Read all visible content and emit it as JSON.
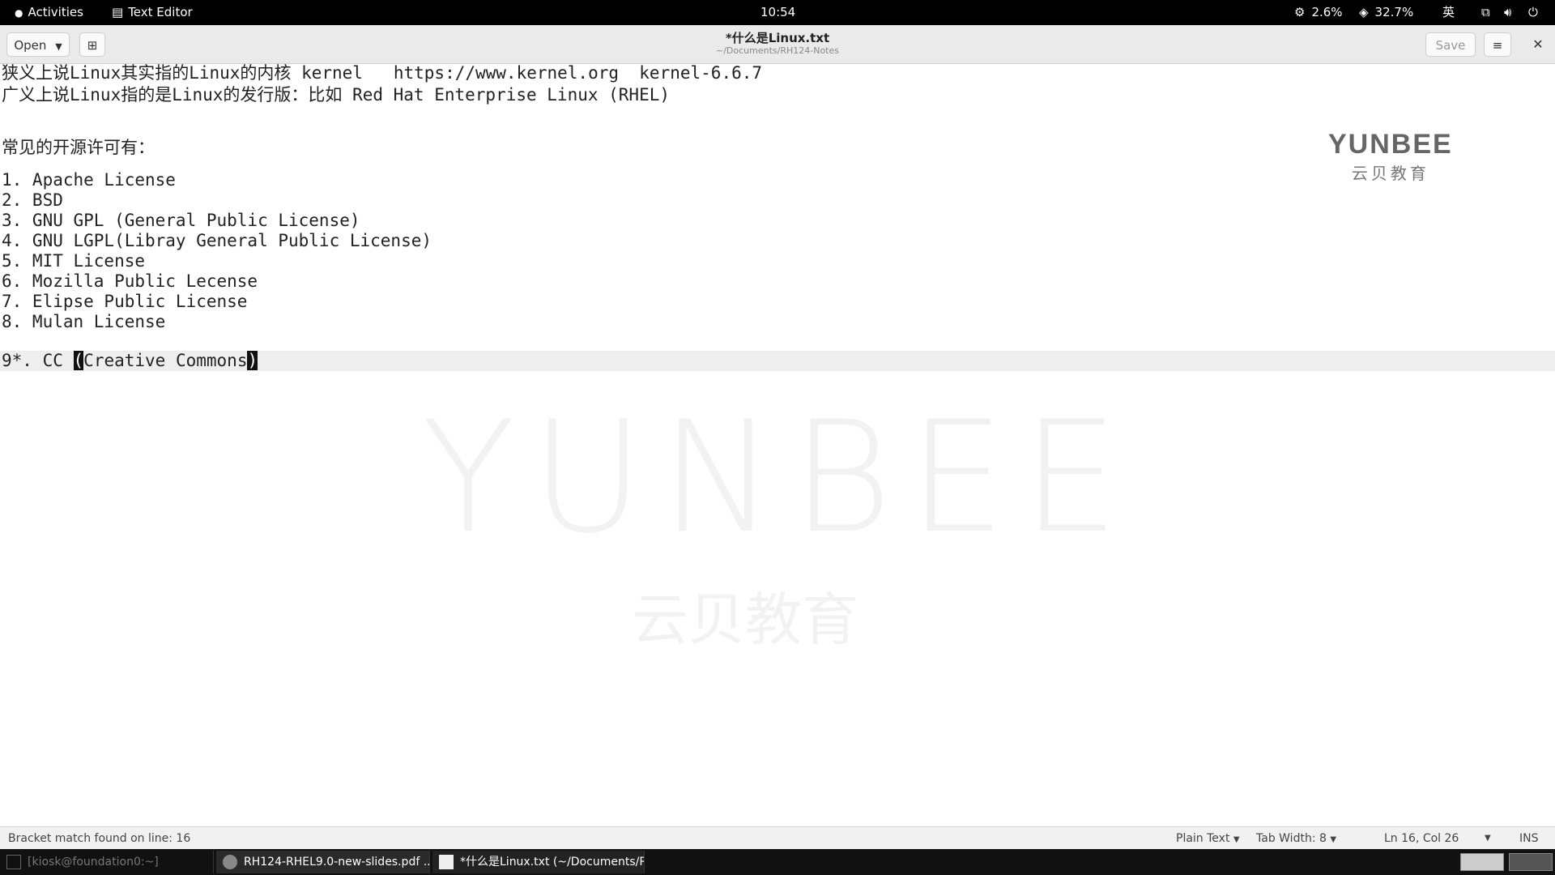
{
  "topbar": {
    "activities": "Activities",
    "app_name": "Text Editor",
    "clock": "10:54",
    "cpu": "2.6%",
    "mem": "32.7%",
    "input_method": "英"
  },
  "header": {
    "open_label": "Open",
    "title": "*什么是Linux.txt",
    "subtitle": "~/Documents/RH124-Notes",
    "save_label": "Save"
  },
  "editor": {
    "lines": [
      "狭义上说Linux其实指的Linux的内核 kernel   https://www.kernel.org  kernel-6.6.7",
      "广义上说Linux指的是Linux的发行版：比如 Red Hat Enterprise Linux (RHEL)",
      "常见的开源许可有：",
      "1. Apache License",
      "2. BSD",
      "3. GNU GPL (General Public License)",
      "4. GNU LGPL(Libray General Public License)",
      "5. MIT License",
      "6. Mozilla Public Lecense",
      "7. Elipse Public License",
      "8. Mulan License"
    ],
    "current_line": {
      "prefix": "9*. CC ",
      "open_bracket": "(",
      "middle": "Creative Commons",
      "close_bracket": ")"
    }
  },
  "watermark": {
    "big": "YUNBEE",
    "cn": "云贝教育",
    "logo_en": "YUNBEE",
    "logo_cn": "云贝教育"
  },
  "statusbar": {
    "message": "Bracket match found on line: 16",
    "language": "Plain Text",
    "tab_width": "Tab Width: 8",
    "position": "Ln 16, Col 26",
    "mode": "INS"
  },
  "taskbar": {
    "tasks": [
      "[kiosk@foundation0:~]",
      "RH124-RHEL9.0-new-slides.pdf ...",
      "*什么是Linux.txt (~/Documents/R..."
    ]
  }
}
